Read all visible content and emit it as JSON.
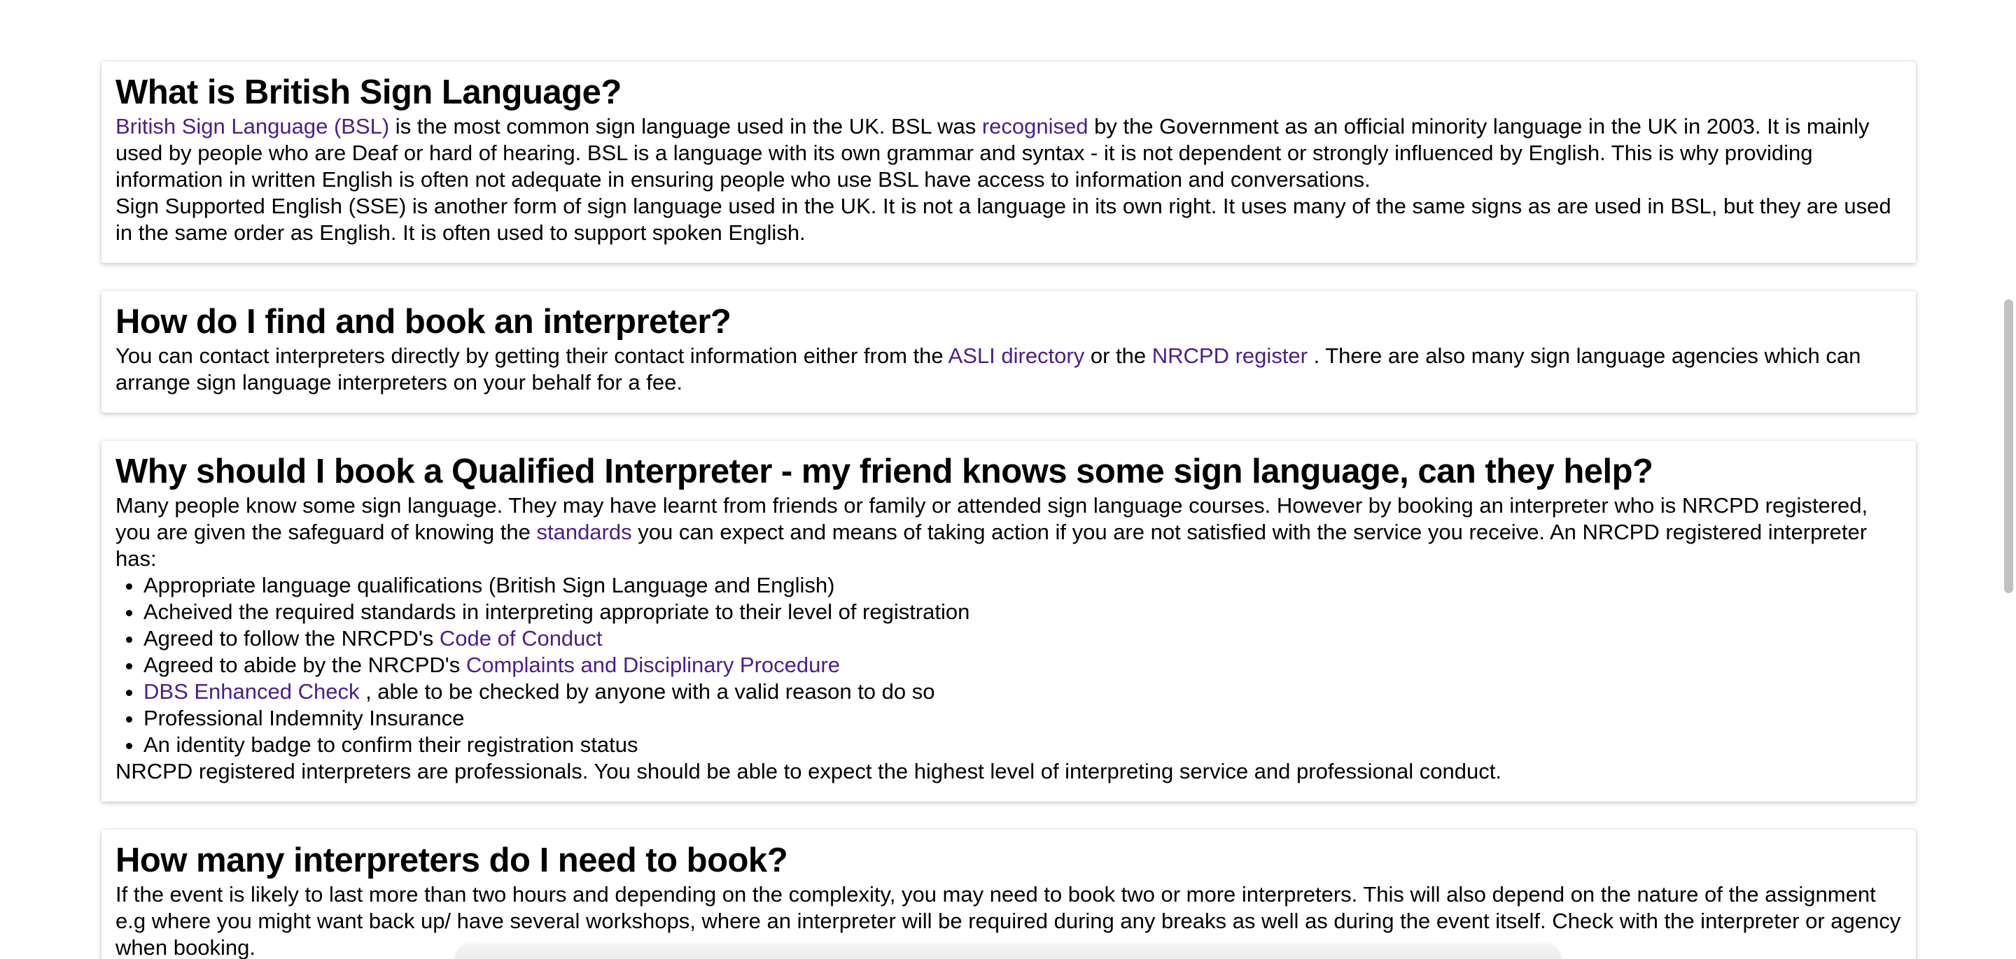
{
  "sections": [
    {
      "heading": "What is British Sign Language?",
      "p1": {
        "link1": "British Sign Language (BSL)",
        "t1": " is the most common sign language used in the UK. BSL was ",
        "link2": "recognised",
        "t2": " by the Government as an official minority language in the UK in 2003. It is mainly used by people who are Deaf or hard of hearing. BSL is a language with its own grammar and syntax - it is not dependent or strongly influenced by English. This is why providing information in written English is often not adequate in ensuring people who use BSL have access to information and conversations."
      },
      "p2": "Sign Supported English (SSE) is another form of sign language used in the UK. It is not a language in its own right. It uses many of the same signs as are used in BSL, but they are used in the same order as English. It is often used to support spoken English."
    },
    {
      "heading": "How do I find and book an interpreter?",
      "p1": {
        "t1": "You can contact interpreters directly by getting their contact information either from the ",
        "link1": "ASLI directory",
        "t2": " or the ",
        "link2": "NRCPD register",
        "t3": " . There are also many sign language agencies which can arrange sign language interpreters on your behalf for a fee."
      }
    },
    {
      "heading": "Why should I book a Qualified Interpreter - my friend knows some sign language, can they help?",
      "p1": {
        "t1": "Many people know some sign language. They may have learnt from friends or family or attended sign language courses. However by booking an interpreter who is NRCPD registered, you are given the safeguard of knowing the ",
        "link1": "standards",
        "t2": " you can expect and means of taking action if you are not satisfied with the service you receive. An NRCPD registered interpreter has:"
      },
      "list": {
        "item1": "Appropriate language qualifications (British Sign Language and English)",
        "item2": "Acheived the required standards in interpreting appropriate to their level of registration",
        "item3_text": "Agreed to follow the NRCPD's ",
        "item3_link": "Code of Conduct",
        "item4_text": "Agreed to abide by the NRCPD's ",
        "item4_link": "Complaints and Disciplinary Procedure",
        "item5_link": "DBS Enhanced Check",
        "item5_text": " , able to be checked by anyone with a valid reason to do so",
        "item6": "Professional Indemnity Insurance",
        "item7": "An identity badge to confirm their registration status"
      },
      "p2": "NRCPD registered interpreters are professionals. You should be able to expect the highest level of interpreting service and professional conduct."
    },
    {
      "heading": "How many interpreters do I need to book?",
      "p1": "If the event is likely to last more than two hours and depending on the complexity, you may need to book two or more interpreters. This will also depend on the nature of the assignment e.g where you might want back up/ have several workshops, where an interpreter will be required during any breaks as well as during the event itself. Check with the interpreter or agency when booking."
    }
  ],
  "colors": {
    "link": "#4b1d8c",
    "text": "#000000",
    "card_background": "#ffffff",
    "scrollbar_thumb": "#c1c1c1"
  }
}
